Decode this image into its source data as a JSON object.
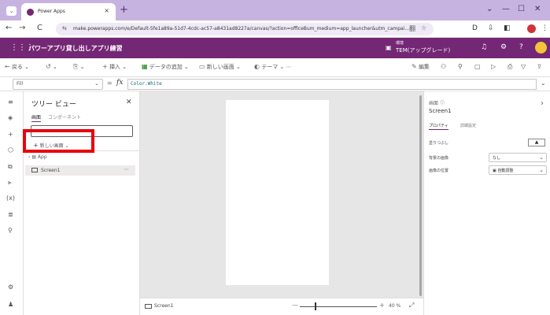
{
  "browser": {
    "tab_list_glyph": "⌄",
    "tab_title": "Power Apps",
    "tab_close": "×",
    "new_tab": "+",
    "window_controls": [
      "⌄",
      "—",
      "☐",
      "✕"
    ],
    "nav": {
      "back": "←",
      "forward": "→",
      "reload": "C"
    },
    "omnibox_icon": "⇆",
    "url": "make.powerapps.com/e/Default-5fe1a89a-51d7-4cdc-ac57-a8431ad8227a/canvas/?action=officeBum_medium=app_launcher&utm_campai...",
    "omnibox_icons": [
      "翻",
      "☆"
    ],
    "toolbar_icons": [
      "D",
      "⇩",
      "◧",
      "⋮"
    ]
  },
  "app_header": {
    "waffle": "⋮⋮⋮",
    "title": "パワーアプリ貸し出しアプリ練習",
    "env_label": "環境",
    "env_name": "TEM(アップグレード)",
    "icons": [
      "♫",
      "⚙",
      "?"
    ]
  },
  "commands": [
    {
      "icon": "←",
      "label": "戻る"
    },
    {
      "icon": "↺",
      "label": ""
    },
    {
      "icon": "⎘",
      "label": ""
    },
    {
      "icon": "+",
      "label": "挿入"
    },
    {
      "icon": "▦",
      "label": "データの追加"
    },
    {
      "icon": "▭",
      "label": "新しい画面"
    },
    {
      "icon": "◐",
      "label": "テーマ"
    }
  ],
  "command_right": {
    "edit": "編集",
    "icons": [
      "⚇",
      "⚲",
      "▢",
      "▷",
      "⎙",
      "▽",
      "⇪"
    ]
  },
  "formula_bar": {
    "property": "Fill",
    "equals": "=",
    "fx": "fx",
    "formula": "Color.White",
    "caret": "⌄"
  },
  "rail_icons": [
    "≡",
    "◈",
    "+",
    "⬡",
    "⧉",
    "⫸",
    "(x)",
    "≣",
    "⚲",
    "⚙",
    "♟"
  ],
  "tree_view": {
    "title": "ツリー ビュー",
    "close": "✕",
    "tabs": [
      "画面",
      "コンポーネント"
    ],
    "search_placeholder": "",
    "new_screen": "新しい画面",
    "new_screen_icon": "+",
    "chevron": "⌄",
    "app_item": "App",
    "screen_item": "Screen1",
    "more": "⋯"
  },
  "canvas": {
    "screen_name": "Screen1",
    "zoom_minus": "—",
    "zoom_plus": "+",
    "zoom": "40 %",
    "zoom_level": 0.2,
    "expand": "⤢"
  },
  "properties": {
    "kind": "画面",
    "name": "Screen1",
    "chevron": "›",
    "tabs": [
      "プロパティ",
      "詳細設定"
    ],
    "rows": [
      {
        "label": "塗りつぶし",
        "value": ""
      },
      {
        "label": "背景の画像",
        "value": "なし"
      },
      {
        "label": "画像の位置",
        "value": "▣ 自動調整"
      }
    ],
    "fill_glyph": "▲"
  }
}
